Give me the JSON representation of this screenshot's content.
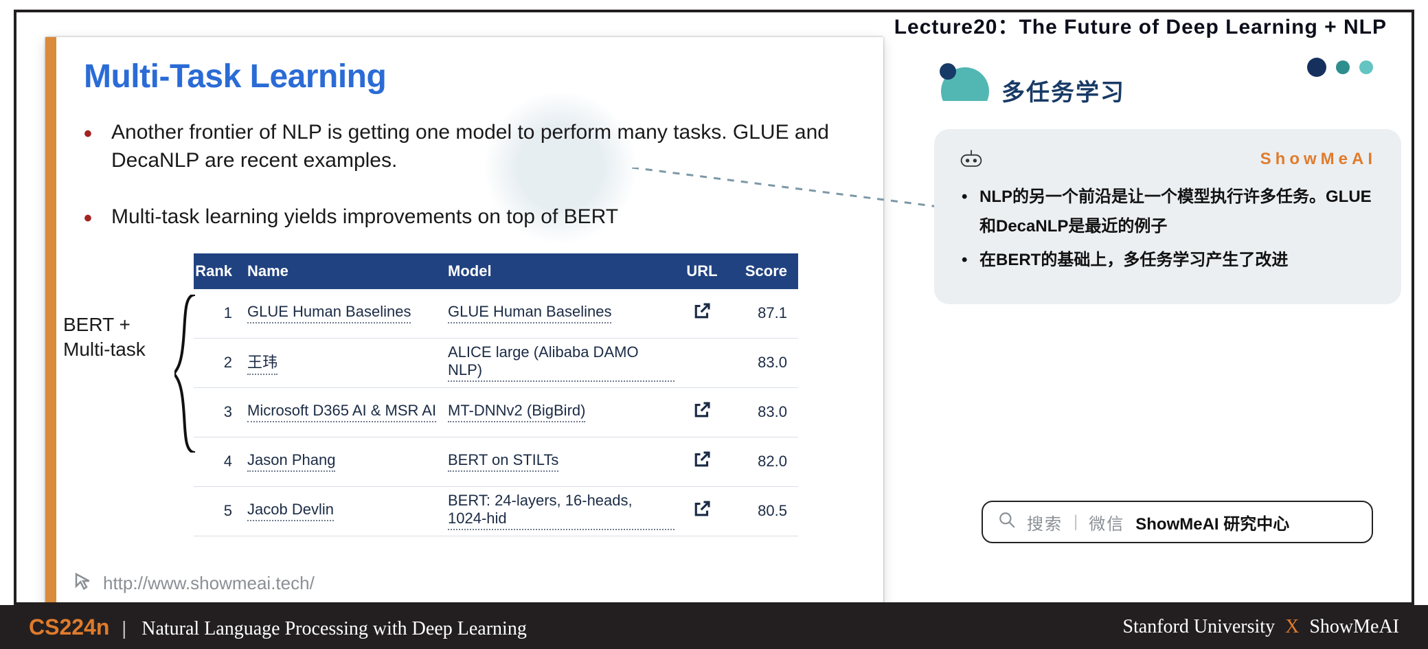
{
  "header": {
    "lecture": "Lecture20：The Future of Deep Learning + NLP"
  },
  "slide": {
    "title": "Multi-Task Learning",
    "bullets": [
      "Another frontier of NLP is getting one model to perform many tasks. GLUE and DecaNLP are recent examples.",
      "Multi-task learning yields improvements on top of BERT"
    ],
    "annotation": "BERT + Multi-task",
    "footer_link": "http://www.showmeai.tech/"
  },
  "leaderboard": {
    "columns": {
      "rank": "Rank",
      "name": "Name",
      "model": "Model",
      "url": "URL",
      "score": "Score"
    },
    "rows": [
      {
        "rank": "1",
        "name": "GLUE Human Baselines",
        "model": "GLUE Human Baselines",
        "has_url": true,
        "score": "87.1"
      },
      {
        "rank": "2",
        "name": "王玮",
        "model": "ALICE large (Alibaba DAMO NLP)",
        "has_url": false,
        "score": "83.0"
      },
      {
        "rank": "3",
        "name": "Microsoft D365 AI & MSR AI",
        "model": "MT-DNNv2 (BigBird)",
        "has_url": true,
        "score": "83.0"
      },
      {
        "rank": "4",
        "name": "Jason Phang",
        "model": "BERT on STILTs",
        "has_url": true,
        "score": "82.0"
      },
      {
        "rank": "5",
        "name": "Jacob Devlin",
        "model": "BERT: 24-layers, 16-heads, 1024-hid",
        "has_url": true,
        "score": "80.5"
      }
    ]
  },
  "right": {
    "title": "多任务学习",
    "brand": "ShowMeAI",
    "bullets": [
      "NLP的另一个前沿是让一个模型执行许多任务。GLUE 和DecaNLP是最近的例子",
      "在BERT的基础上，多任务学习产生了改进"
    ]
  },
  "search": {
    "hint1": "搜索",
    "hint2": "微信",
    "strong": "ShowMeAI 研究中心"
  },
  "bottom": {
    "course": "CS224n",
    "subtitle": "Natural Language Processing with Deep Learning",
    "uni": "Stanford University",
    "org": "ShowMeAI"
  },
  "chart_data": {
    "type": "table",
    "title": "GLUE Leaderboard (Multi-Task Learning improvements over BERT)",
    "columns": [
      "Rank",
      "Name",
      "Model",
      "Score"
    ],
    "rows": [
      [
        1,
        "GLUE Human Baselines",
        "GLUE Human Baselines",
        87.1
      ],
      [
        2,
        "王玮",
        "ALICE large (Alibaba DAMO NLP)",
        83.0
      ],
      [
        3,
        "Microsoft D365 AI & MSR AI",
        "MT-DNNv2 (BigBird)",
        83.0
      ],
      [
        4,
        "Jason Phang",
        "BERT on STILTs",
        82.0
      ],
      [
        5,
        "Jacob Devlin",
        "BERT: 24-layers, 16-heads, 1024-hid",
        80.5
      ]
    ]
  }
}
